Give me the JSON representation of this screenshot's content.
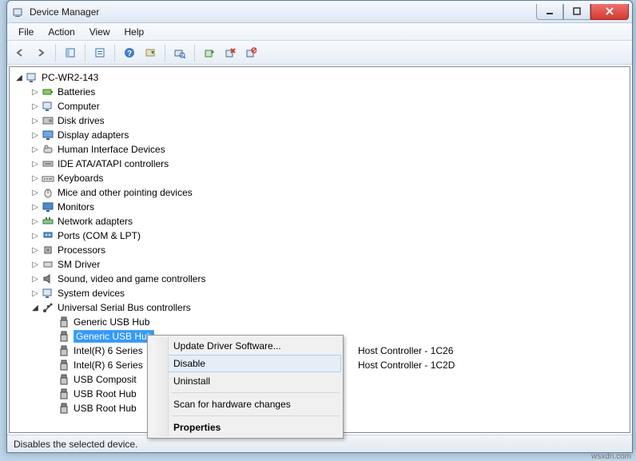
{
  "window": {
    "title": "Device Manager"
  },
  "menu": {
    "file": "File",
    "action": "Action",
    "view": "View",
    "help": "Help"
  },
  "tree": {
    "root": "PC-WR2-143",
    "categories": [
      "Batteries",
      "Computer",
      "Disk drives",
      "Display adapters",
      "Human Interface Devices",
      "IDE ATA/ATAPI controllers",
      "Keyboards",
      "Mice and other pointing devices",
      "Monitors",
      "Network adapters",
      "Ports (COM & LPT)",
      "Processors",
      "SM Driver",
      "Sound, video and game controllers",
      "System devices",
      "Universal Serial Bus controllers"
    ],
    "usb_children": [
      "Generic USB Hub",
      "Generic USB Hub",
      "Intel(R) 6 Series",
      "Intel(R) 6 Series",
      "USB Composit",
      "USB Root Hub",
      "USB Root Hub"
    ],
    "usb_right": {
      "2": "Host Controller - 1C26",
      "3": "Host Controller - 1C2D"
    }
  },
  "context_menu": {
    "items": [
      "Update Driver Software...",
      "Disable",
      "Uninstall",
      "Scan for hardware changes",
      "Properties"
    ]
  },
  "statusbar": {
    "text": "Disables the selected device."
  },
  "watermark": "wsxdn.com"
}
